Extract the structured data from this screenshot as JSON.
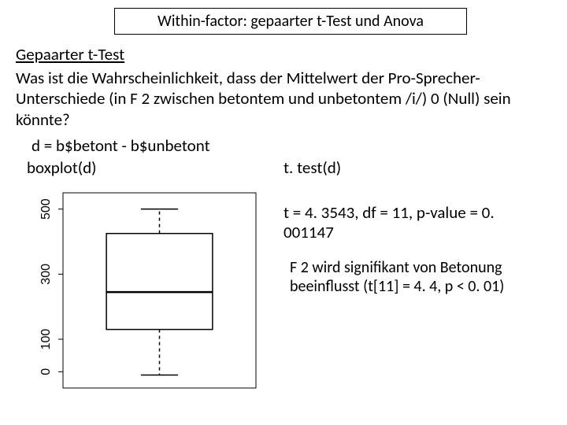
{
  "title": "Within-factor: gepaarter t-Test und Anova",
  "subtitle": "Gepaarter t-Test",
  "question": "Was ist die Wahrscheinlichkeit, dass der Mittelwert der Pro-Sprecher-Unterschiede (in F 2 zwischen betontem und unbetontem /i/) 0 (Null) sein könnte?",
  "code_assign": "d = b$betont - b$unbetont",
  "code_boxplot": "boxplot(d)",
  "code_ttest": "t. test(d)",
  "ttest_result": "t = 4. 3543, df = 11, p-value = 0. 001147",
  "conclusion": "F 2 wird signifikant von Betonung beeinflusst (t[11] = 4. 4, p < 0. 01)",
  "chart_data": {
    "type": "boxplot",
    "title": "",
    "xlabel": "",
    "ylabel": "",
    "ylim": [
      -50,
      550
    ],
    "yticks": [
      0,
      100,
      300,
      500
    ],
    "box": {
      "min_whisker": -10,
      "q1": 130,
      "median": 245,
      "q3": 425,
      "max_whisker": 500
    }
  }
}
